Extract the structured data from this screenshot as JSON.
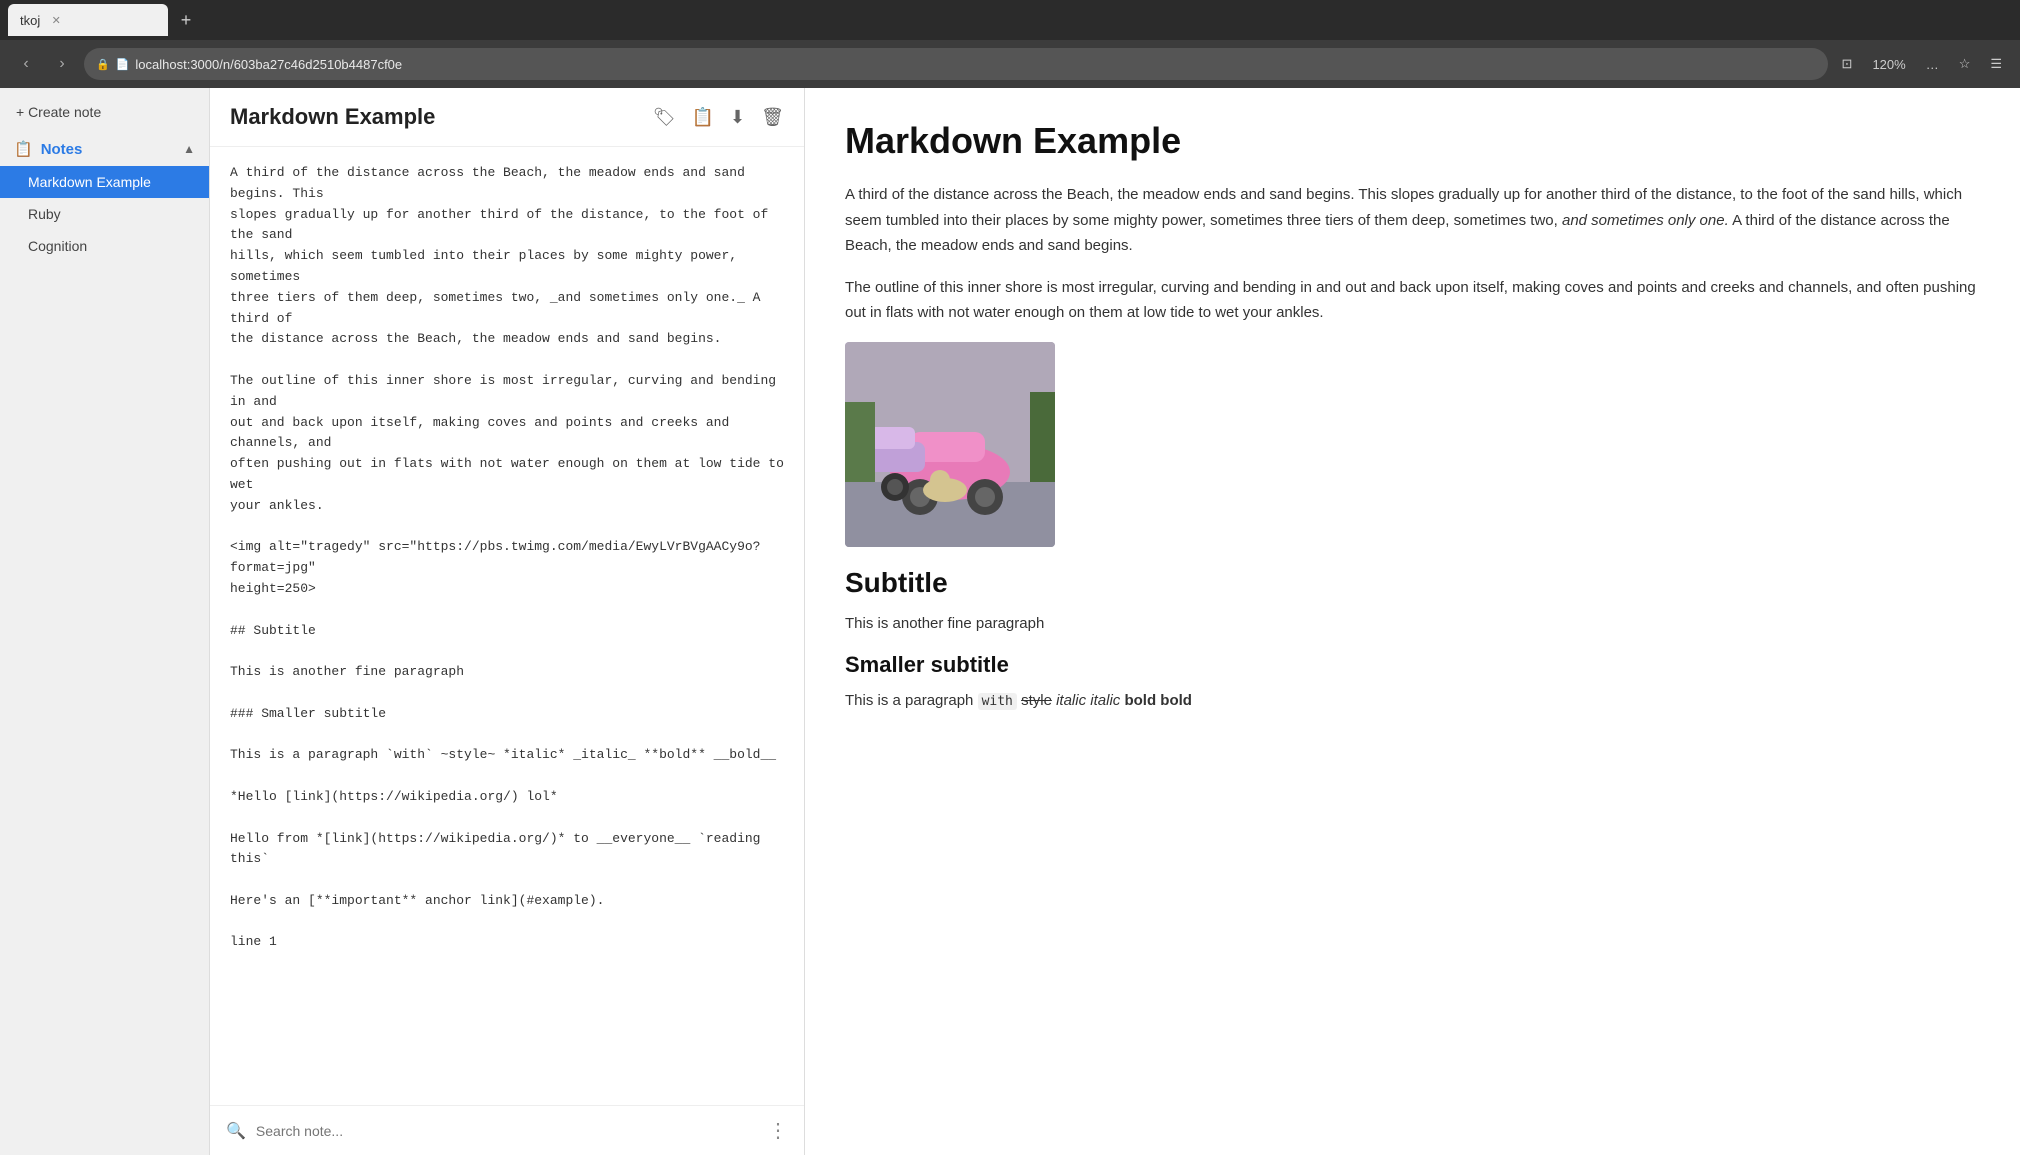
{
  "browser": {
    "tab_title": "tkoj",
    "url": "localhost:3000/n/603ba27c46d2510b4487cf0e",
    "zoom": "120%"
  },
  "sidebar": {
    "create_note_label": "+ Create note",
    "notes_section_label": "Notes",
    "notes": [
      {
        "id": "markdown-example",
        "label": "Markdown Example",
        "active": true
      },
      {
        "id": "ruby",
        "label": "Ruby",
        "active": false
      },
      {
        "id": "cognition",
        "label": "Cognition",
        "active": false
      }
    ]
  },
  "editor": {
    "title": "Markdown Example",
    "content": "A third of the distance across the Beach, the meadow ends and sand begins. This\nslopes gradually up for another third of the distance, to the foot of the sand\nhills, which seem tumbled into their places by some mighty power, sometimes\nthree tiers of them deep, sometimes two, _and sometimes only one._ A third of\nthe distance across the Beach, the meadow ends and sand begins.\n\nThe outline of this inner shore is most irregular, curving and bending in and\nout and back upon itself, making coves and points and creeks and channels, and\noften pushing out in flats with not water enough on them at low tide to wet\nyour ankles.\n\n<img alt=\"tragedy\" src=\"https://pbs.twimg.com/media/EwyLVrBVgAACy9o?format=jpg\"\nheight=250>\n\n## Subtitle\n\nThis is another fine paragraph\n\n### Smaller subtitle\n\nThis is a paragraph `with` ~style~ *italic* _italic_ **bold** __bold__\n\n*Hello [link](https://wikipedia.org/) lol*\n\nHello from *[link](https://wikipedia.org/)* to __everyone__ `reading this`\n\nHere's an [**important** anchor link](#example).\n\nline 1",
    "search_placeholder": "Search note..."
  },
  "preview": {
    "title": "Markdown Example",
    "para1": "A third of the distance across the Beach, the meadow ends and sand begins. This slopes gradually up for another third of the distance, to the foot of the sand hills, which seem tumbled into their places by some mighty power, sometimes three tiers of them deep, sometimes two,",
    "para1_italic": "and sometimes only one.",
    "para1_end": " A third of the distance across the Beach, the meadow ends and sand begins.",
    "para2": "The outline of this inner shore is most irregular, curving and bending in and out and back upon itself, making coves and points and creeks and channels, and often pushing out in flats with not water enough on them at low tide to wet your ankles.",
    "subtitle": "Subtitle",
    "para3": "This is another fine paragraph",
    "smaller_subtitle": "Smaller subtitle",
    "para4_before": "This is a paragraph",
    "para4_code": "with",
    "para4_after1": "style",
    "para4_italic1": "italic italic",
    "para4_bold": "bold bold"
  },
  "icons": {
    "tag": "🏷",
    "export": "📋",
    "download": "⬇",
    "trash": "🗑",
    "search": "🔍",
    "more": "⋮"
  }
}
